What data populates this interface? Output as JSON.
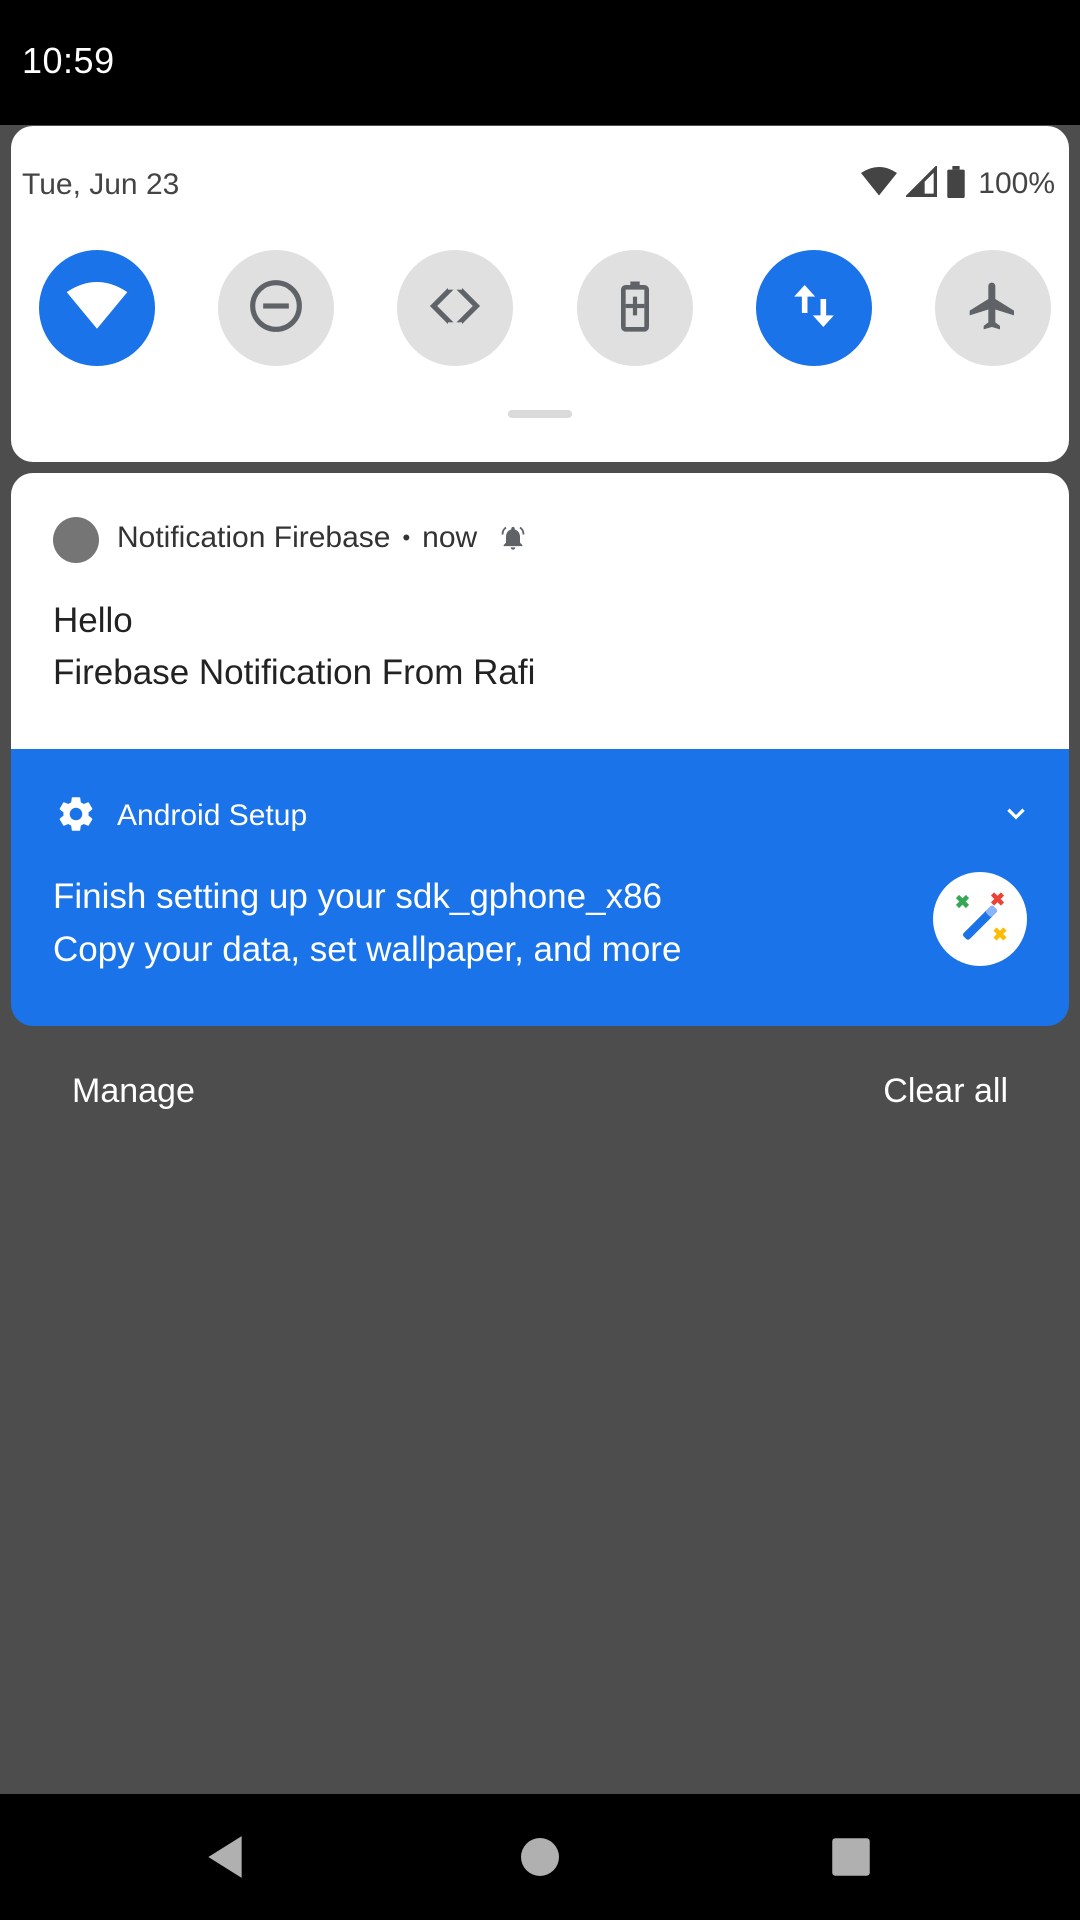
{
  "status_bar": {
    "time": "10:59"
  },
  "quick_settings": {
    "date": "Tue, Jun 23",
    "battery_percent": "100%",
    "tiles": [
      {
        "name": "wifi",
        "icon": "wifi-icon",
        "active": true
      },
      {
        "name": "do-not-disturb",
        "icon": "do-not-disturb-icon",
        "active": false
      },
      {
        "name": "auto-rotate",
        "icon": "auto-rotate-icon",
        "active": false
      },
      {
        "name": "battery-saver",
        "icon": "battery-saver-icon",
        "active": false
      },
      {
        "name": "mobile-data",
        "icon": "mobile-data-icon",
        "active": true
      },
      {
        "name": "airplane-mode",
        "icon": "airplane-icon",
        "active": false
      }
    ],
    "active_color": "#1a73e8",
    "inactive_color": "#e0e0e0"
  },
  "notifications": [
    {
      "app_name": "Notification Firebase",
      "separator": "•",
      "time": "now",
      "title": "Hello",
      "text": "Firebase Notification From Rafi",
      "alert_icon": "bell-alert-icon"
    },
    {
      "app_name": "Android Setup",
      "title": "Finish setting up your sdk_gphone_x86",
      "text": "Copy your data, set wallpaper, and more",
      "app_icon": "gear-icon",
      "large_icon": "magic-wand-icon",
      "background": "#1a73e8"
    }
  ],
  "footer_actions": {
    "manage": "Manage",
    "clear_all": "Clear all"
  },
  "nav_bar": {
    "buttons": [
      "back-icon",
      "home-icon",
      "recents-icon"
    ]
  }
}
